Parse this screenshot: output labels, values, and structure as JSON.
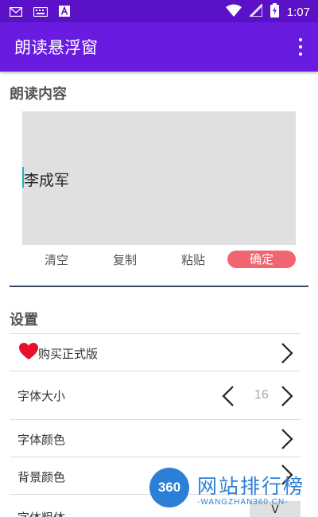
{
  "status_bar": {
    "time": "1:07",
    "icons": [
      "gmail-icon",
      "keyboard-icon",
      "text-a-icon",
      "wifi-icon",
      "signal-icon",
      "battery-charging-icon"
    ],
    "color": "#5b12c7"
  },
  "app_bar": {
    "title": "朗读悬浮窗",
    "color": "#6a1be0"
  },
  "read_section": {
    "title": "朗读内容",
    "text_value": "李成军",
    "actions": {
      "clear": "清空",
      "copy": "复制",
      "paste": "粘贴",
      "confirm": "确定"
    },
    "confirm_color": "#f06670"
  },
  "settings": {
    "title": "设置",
    "buy_label": "购买正式版",
    "font_size_label": "字体大小",
    "font_size_value": "16",
    "font_color_label": "字体颜色",
    "bg_color_label": "背景颜色",
    "partial_label": "字体粗体"
  },
  "watermark": {
    "badge": "360",
    "title": "网站排行榜",
    "subtitle": "-WANGZHAN360.CN-"
  },
  "bottom_button_glyph": "V"
}
